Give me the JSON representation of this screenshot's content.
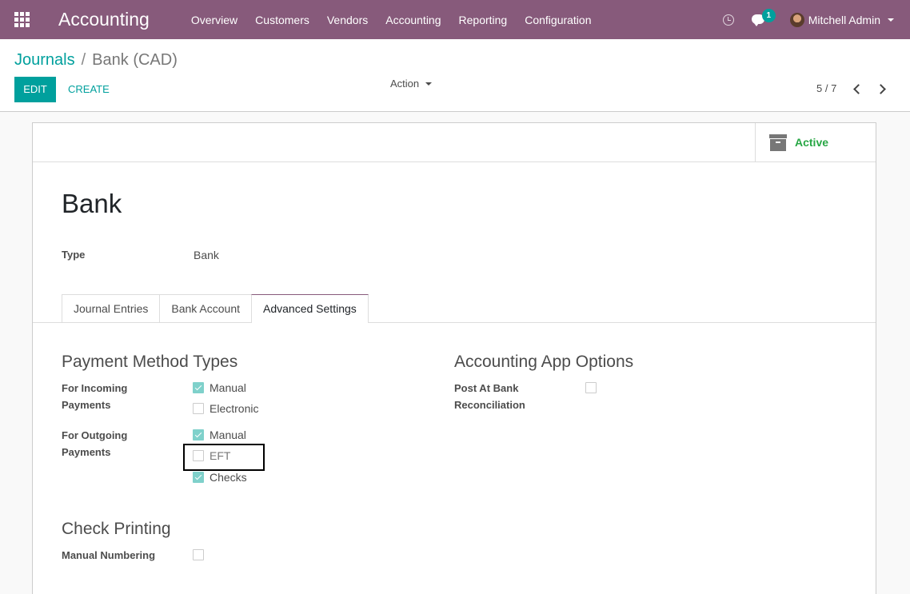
{
  "navbar": {
    "app_title": "Accounting",
    "menu": [
      "Overview",
      "Customers",
      "Vendors",
      "Accounting",
      "Reporting",
      "Configuration"
    ],
    "chat_count": "1",
    "user_name": "Mitchell Admin",
    "color": "#875a7b"
  },
  "control_panel": {
    "breadcrumb_parent": "Journals",
    "breadcrumb_separator": "/",
    "breadcrumb_current": "Bank (CAD)",
    "edit_label": "EDIT",
    "create_label": "CREATE",
    "action_label": "Action",
    "pager": "5 / 7",
    "accent_color": "#00a09d"
  },
  "form": {
    "status_button": "Active",
    "title": "Bank",
    "type_label": "Type",
    "type_value": "Bank",
    "tabs": [
      "Journal Entries",
      "Bank Account",
      "Advanced Settings"
    ],
    "active_tab": "Advanced Settings",
    "payment_methods": {
      "title": "Payment Method Types",
      "incoming_label": "For Incoming Payments",
      "incoming": [
        {
          "label": "Manual",
          "checked": true
        },
        {
          "label": "Electronic",
          "checked": false
        }
      ],
      "outgoing_label": "For Outgoing Payments",
      "outgoing": [
        {
          "label": "Manual",
          "checked": true
        },
        {
          "label": "EFT",
          "checked": false
        },
        {
          "label": "Checks",
          "checked": true
        }
      ]
    },
    "app_options": {
      "title": "Accounting App Options",
      "post_at_bank_label": "Post At Bank Reconciliation",
      "post_at_bank_checked": false
    },
    "check_printing": {
      "title": "Check Printing",
      "manual_numbering_label": "Manual Numbering",
      "manual_numbering_checked": false
    }
  }
}
